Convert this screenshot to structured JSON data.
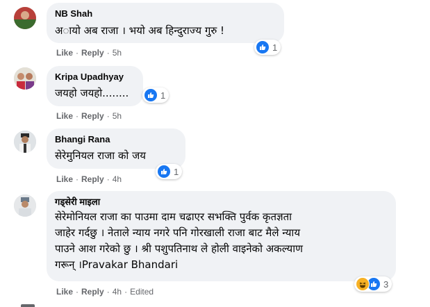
{
  "actions": {
    "like": "Like",
    "reply": "Reply",
    "edited": "Edited"
  },
  "comments": [
    {
      "author": "NB Shah",
      "text": "अायो अब राजा । भयो अब हिन्दुराज्य गुरु !",
      "time": "5h",
      "reactions": "1"
    },
    {
      "author": "Kripa Upadhyay",
      "text": "जयहो जयहो........",
      "time": "5h",
      "reactions": "1"
    },
    {
      "author": "Bhangi Rana",
      "text": "सेरेमुनियल राजा को जय",
      "time": "4h",
      "reactions": "1"
    },
    {
      "author": "गड्सेरी माइला",
      "text": "सेरेमोनियल राजा का पाउमा दाम चढाएर सभक्ति पुर्वक कृतज्ञता\nजाहेर गर्दछु । नेताले न्याय नगरे पनि गोरखाली राजा बाट मैले न्याय\nपाउने आश गरेको छु । श्री पशुपतिनाथ ले होली वाइनेको अकल्याण\nगरून् ।Pravakar Bhandari",
      "time": "4h",
      "reactions": "3"
    }
  ],
  "colors": {
    "like_blue": "#1877f2",
    "haha_yellow": "#f7b125",
    "bubble_bg": "#f0f2f5",
    "meta_gray": "#65676b"
  }
}
